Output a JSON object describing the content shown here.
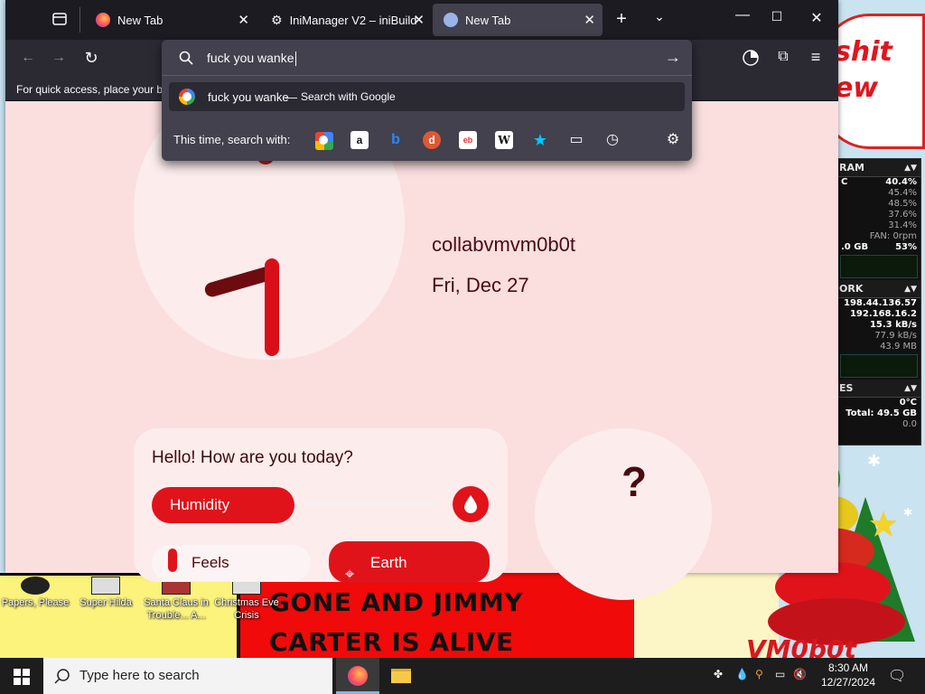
{
  "browser": {
    "tabs": [
      {
        "title": "New Tab",
        "icon": "firefox-icon",
        "active": false
      },
      {
        "title": "IniManager V2 – iniBuilds",
        "icon": "gear-icon",
        "active": false
      },
      {
        "title": "New Tab",
        "icon": "firefox-view-icon",
        "active": true
      }
    ],
    "bookmarks_hint": "For quick access, place your b",
    "urlbar": {
      "value": "fuck you wanke",
      "suggestion_query": "fuck you wanke",
      "suggestion_sep": "—",
      "suggestion_action": "Search with Google",
      "search_with_label": "This time, search with:",
      "engines": [
        "google",
        "amazon",
        "bing",
        "duckduckgo",
        "ebay",
        "wikipedia",
        "bookmarks",
        "tabs",
        "history",
        "settings"
      ]
    }
  },
  "newtab": {
    "username": "collabvmvm0b0t",
    "date": "Fri, Dec 27",
    "greeting": "Hello! How are you today?",
    "humidity_label": "Humidity",
    "feels_label": "Feels",
    "location_label": "Earth",
    "weather_unknown": "?"
  },
  "desktop": {
    "bubble_text_1": "shit",
    "bubble_text_2": "ew",
    "wallpaper_line_1": "GONE AND JIMMY",
    "wallpaper_line_2": "CARTER IS ALIVE",
    "watermark": "VM0b0t",
    "icons": [
      {
        "label": "Papers, Please"
      },
      {
        "label": "Super Hilda"
      },
      {
        "label": "Santa Claus in Trouble... A..."
      },
      {
        "label": "Christmas Eve Crisis"
      }
    ]
  },
  "gadget": {
    "ram_header": "RAM",
    "ram_rows": [
      "C",
      "40.4%",
      "45.4%",
      "48.5%",
      "37.6%",
      "31.4%",
      "FAN: 0rpm"
    ],
    "ram_total": ".0 GB",
    "ram_pct": "53%",
    "net_header": "ORK",
    "net_rows": [
      "198.44.136.57",
      "192.168.16.2",
      "15.3 kB/s",
      "77.9 kB/s",
      "43.9 MB"
    ],
    "drives_header": "ES",
    "drives_rows": [
      "0°C",
      "Total: 49.5 GB",
      "0.0"
    ]
  },
  "taskbar": {
    "search_placeholder": "Type here to search",
    "time": "8:30 AM",
    "date": "12/27/2024"
  },
  "colors": {
    "accent_red": "#e0131b",
    "newtab_bg": "#fbdfdf",
    "firefox_dark": "#1c1b22"
  }
}
